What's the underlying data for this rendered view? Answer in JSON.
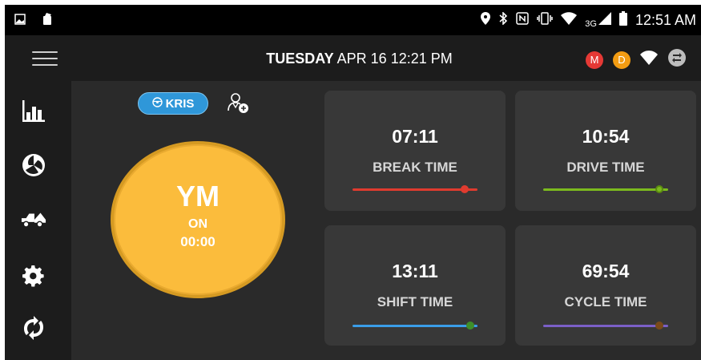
{
  "status_bar": {
    "time": "12:51 AM",
    "network": "3G",
    "icons": [
      "gallery-icon",
      "phone-icon",
      "location-icon",
      "bluetooth-icon",
      "nfc-icon",
      "vibrate-icon",
      "wifi-icon",
      "signal-icon",
      "battery-icon"
    ]
  },
  "header": {
    "day": "TUESDAY",
    "date": "APR 16",
    "time": "12:21 PM",
    "badges": [
      {
        "label": "M",
        "color": "#e53935"
      },
      {
        "label": "D",
        "color": "#f39c12"
      }
    ]
  },
  "sidebar": {
    "items": [
      {
        "icon": "bar-chart-icon"
      },
      {
        "icon": "aperture-icon"
      },
      {
        "icon": "truck-icon"
      },
      {
        "icon": "gear-icon"
      },
      {
        "icon": "sync-icon"
      }
    ]
  },
  "driver": {
    "name": "Kris",
    "add_icon": "add-driver-icon"
  },
  "duty": {
    "code": "YM",
    "status": "ON",
    "timer": "00:00",
    "color": "#fbbc3c"
  },
  "timers": [
    {
      "value": "07:11",
      "label": "BREAK TIME",
      "color": "#e03b2f",
      "progress": 0.92
    },
    {
      "value": "10:54",
      "label": "DRIVE TIME",
      "color": "#7cba1e",
      "progress": 0.92
    },
    {
      "value": "13:11",
      "label": "SHIFT TIME",
      "color": "#3a9de8",
      "progress": 0.92
    },
    {
      "value": "69:54",
      "label": "CYCLE TIME",
      "color": "#7b5fc7",
      "progress": 0.92
    }
  ]
}
